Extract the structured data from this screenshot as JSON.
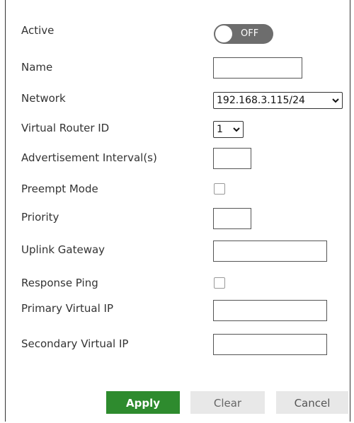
{
  "form": {
    "active": {
      "label": "Active",
      "toggle_text": "OFF"
    },
    "name": {
      "label": "Name",
      "value": ""
    },
    "network": {
      "label": "Network",
      "selected": "192.168.3.115/24"
    },
    "virtual_router_id": {
      "label": "Virtual Router ID",
      "selected": "1"
    },
    "advertisement_interval": {
      "label": "Advertisement Interval(s)",
      "value": ""
    },
    "preempt_mode": {
      "label": "Preempt Mode",
      "checked": false
    },
    "priority": {
      "label": "Priority",
      "value": ""
    },
    "uplink_gateway": {
      "label": "Uplink Gateway",
      "value": ""
    },
    "response_ping": {
      "label": "Response Ping",
      "checked": false
    },
    "primary_virtual_ip": {
      "label": "Primary Virtual IP",
      "value": ""
    },
    "secondary_virtual_ip": {
      "label": "Secondary Virtual IP",
      "value": ""
    }
  },
  "buttons": {
    "apply": "Apply",
    "clear": "Clear",
    "cancel": "Cancel"
  },
  "colors": {
    "apply_bg": "#2e8b2e",
    "toggle_off_bg": "#6d6d6d",
    "secondary_button_bg": "#e8e8e8"
  },
  "icons": {
    "select_arrow": "chevron-down-icon"
  }
}
